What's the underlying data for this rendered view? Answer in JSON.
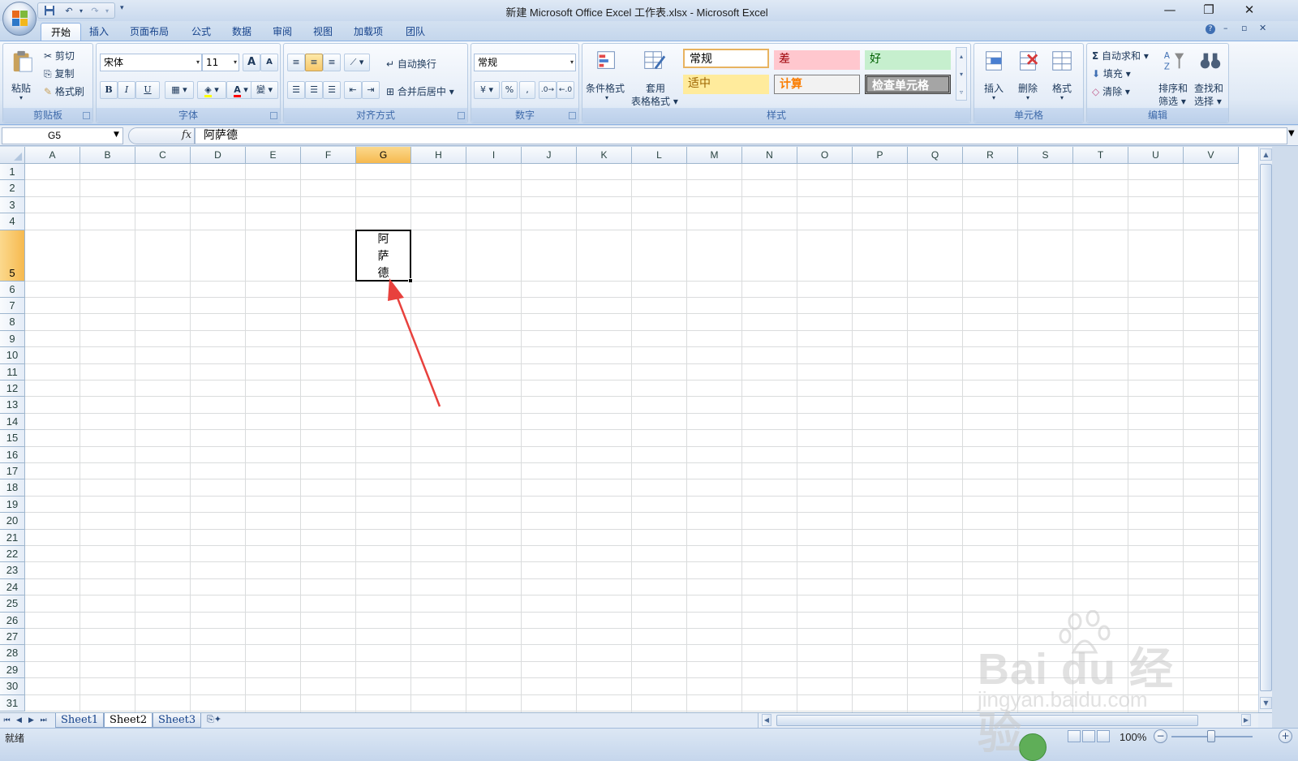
{
  "window": {
    "title": "新建 Microsoft Office Excel 工作表.xlsx - Microsoft Excel",
    "minimize": "—",
    "restore": "❐",
    "close": "✕"
  },
  "ribbon_tabs": [
    "开始",
    "插入",
    "页面布局",
    "公式",
    "数据",
    "审阅",
    "视图",
    "加载项",
    "团队"
  ],
  "active_tab": "开始",
  "clipboard": {
    "label": "剪贴板",
    "paste": "粘贴",
    "cut": "剪切",
    "copy": "复制",
    "format_painter": "格式刷"
  },
  "font": {
    "label": "字体",
    "name": "宋体",
    "size": "11",
    "grow": "A",
    "shrink": "A",
    "bold": "B",
    "italic": "I",
    "underline": "U",
    "phonetic": "變"
  },
  "alignment": {
    "label": "对齐方式",
    "wrap_text": "自动换行",
    "merge_center": "合并后居中"
  },
  "number": {
    "label": "数字",
    "format": "常规",
    "percent": "%",
    "comma": ","
  },
  "styles": {
    "label": "样式",
    "conditional_format": "条件格式",
    "table_format_line1": "套用",
    "table_format_line2": "表格格式",
    "cells": {
      "normal": "常规",
      "bad": "差",
      "good": "好",
      "neutral": "适中",
      "calculation": "计算",
      "check_cell": "检查单元格"
    }
  },
  "cells_group": {
    "label": "单元格",
    "insert": "插入",
    "delete": "删除",
    "format": "格式"
  },
  "editing": {
    "label": "编辑",
    "autosum": "自动求和",
    "fill": "填充",
    "clear": "清除",
    "sort_filter_line1": "排序和",
    "sort_filter_line2": "筛选",
    "find_select_line1": "查找和",
    "find_select_line2": "选择"
  },
  "formula_bar": {
    "name_box": "G5",
    "fx": "fx",
    "value": "阿萨德"
  },
  "columns": [
    "A",
    "B",
    "C",
    "D",
    "E",
    "F",
    "G",
    "H",
    "I",
    "J",
    "K",
    "L",
    "M",
    "N",
    "O",
    "P",
    "Q",
    "R",
    "S",
    "T",
    "U",
    "V"
  ],
  "rows": [
    "1",
    "2",
    "3",
    "4",
    "5",
    "6",
    "7",
    "8",
    "9",
    "10",
    "11",
    "12",
    "13",
    "14",
    "15",
    "16",
    "17",
    "18",
    "19",
    "20",
    "21",
    "22",
    "23",
    "24",
    "25",
    "26",
    "27",
    "28",
    "29",
    "30",
    "31"
  ],
  "selected_column": "G",
  "selected_row": "5",
  "cell_G5": {
    "line1": "阿",
    "line2": "萨",
    "line3": "德"
  },
  "sheets": [
    "Sheet1",
    "Sheet2",
    "Sheet3"
  ],
  "active_sheet": "Sheet2",
  "status": {
    "ready": "就绪",
    "zoom": "100%"
  },
  "watermark": {
    "logo": "Bai du 经验",
    "url": "jingyan.baidu.com"
  },
  "colors": {
    "annotation_arrow": "#e8413d",
    "selected_header": "#f6b94f",
    "bad_fill": "#ffc7ce",
    "good_fill": "#c6efce",
    "neutral_fill": "#ffeb9c"
  }
}
